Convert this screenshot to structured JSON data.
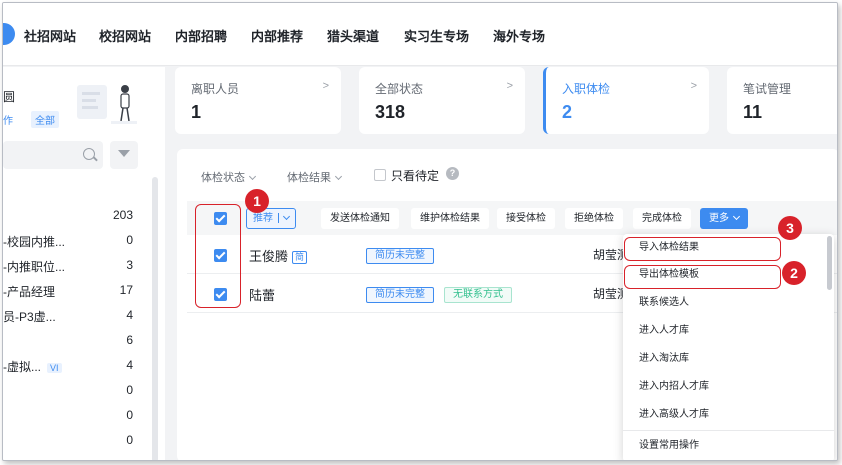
{
  "nav": {
    "items": [
      "社招网站",
      "校招网站",
      "内部招聘",
      "内部推荐",
      "猎头渠道",
      "实习生专场",
      "海外专场"
    ]
  },
  "sidebar": {
    "title": "圆",
    "sub1": "作",
    "sub2": "全部",
    "rows": [
      {
        "label": "",
        "count": "203"
      },
      {
        "label": "-校园内推...",
        "count": "0"
      },
      {
        "label": "-内推职位...",
        "count": "3"
      },
      {
        "label": "-产品经理",
        "count": "17"
      },
      {
        "label": "员-P3虚...",
        "count": "4"
      },
      {
        "label": "",
        "count": "6"
      },
      {
        "label": "-虚拟...",
        "count": "4",
        "badge": "VI"
      },
      {
        "label": "",
        "count": "0"
      },
      {
        "label": "",
        "count": "0"
      },
      {
        "label": "",
        "count": "0"
      }
    ]
  },
  "cards": [
    {
      "title": "离职人员",
      "value": "1"
    },
    {
      "title": "全部状态",
      "value": "318"
    },
    {
      "title": "入职体检",
      "value": "2"
    },
    {
      "title": "笔试管理",
      "value": "11"
    }
  ],
  "card_arrow": ">",
  "filters": {
    "status": "体检状态",
    "result": "体检结果",
    "only_pending": "只看待定",
    "help": "?"
  },
  "toolbar": {
    "recommend": "推荐",
    "send_notice": "发送体检通知",
    "maintain_result": "维护体检结果",
    "accept": "接受体检",
    "reject": "拒绝体检",
    "complete": "完成体检",
    "more": "更多"
  },
  "rows": [
    {
      "name": "王俊腾",
      "resume_icon": "简",
      "tags": [
        "简历未完整"
      ],
      "owner": "胡莹测"
    },
    {
      "name": "陆蕾",
      "tags": [
        "简历未完整",
        "无联系方式"
      ],
      "owner": "胡莹测"
    }
  ],
  "dropdown": {
    "items": [
      "导入体检结果",
      "导出体检模板",
      "联系候选人",
      "进入人才库",
      "进入淘汰库",
      "进入内招人才库",
      "进入高级人才库"
    ],
    "footer": "设置常用操作"
  },
  "annotations": [
    "1",
    "2",
    "3"
  ],
  "colors": {
    "accent": "#3d8bf0",
    "annotation": "#d8222a"
  }
}
